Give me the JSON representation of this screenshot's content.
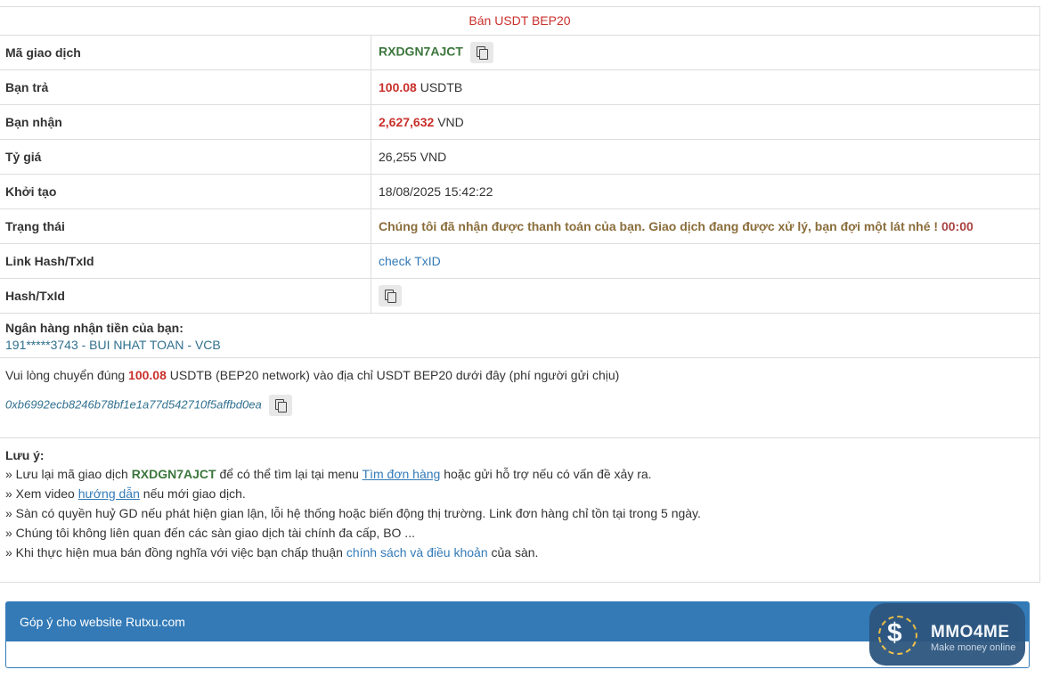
{
  "header": {
    "title": "Bán USDT BEP20"
  },
  "rows": {
    "code": {
      "label": "Mã giao dịch",
      "value": "RXDGN7AJCT"
    },
    "pay": {
      "label": "Bạn trả",
      "amount": "100.08",
      "unit": "USDTB"
    },
    "receive": {
      "label": "Bạn nhận",
      "amount": "2,627,632",
      "unit": "VND"
    },
    "rate": {
      "label": "Tỷ giá",
      "value": "26,255 VND"
    },
    "created": {
      "label": "Khởi tạo",
      "value": "18/08/2025 15:42:22"
    },
    "status": {
      "label": "Trạng thái",
      "value": "Chúng tôi đã nhận được thanh toán của bạn. Giao dịch đang được xử lý, bạn đợi một lát nhé !",
      "timer": "00:00"
    },
    "linkhash": {
      "label": "Link Hash/TxId",
      "value": "check TxID"
    },
    "hash": {
      "label": "Hash/TxId"
    }
  },
  "bank": {
    "title": "Ngân hàng nhận tiền của bạn:",
    "account": "191*****3743 - BUI NHAT TOAN - VCB"
  },
  "transfer": {
    "prefix": "Vui lòng chuyển đúng",
    "amount": "100.08",
    "suffix": "USDTB (BEP20 network) vào địa chỉ USDT BEP20 dưới đây (phí người gửi chịu)",
    "address": "0xb6992ecb8246b78bf1e1a77d542710f5affbd0ea"
  },
  "notes": {
    "title": "Lưu ý:",
    "n1_a": "» Lưu lại mã giao dịch",
    "n1_code": "RXDGN7AJCT",
    "n1_b": "để có thể tìm lại tại menu",
    "n1_link": "Tìm đơn hàng",
    "n1_c": "hoặc gửi hỗ trợ nếu có vấn đề xảy ra.",
    "n2_a": "» Xem video",
    "n2_link": "hướng dẫn",
    "n2_b": "nếu mới giao dịch.",
    "n3": "» Sàn có quyền huỷ GD nếu phát hiện gian lận, lỗi hệ thống hoặc biến động thị trường. Link đơn hàng chỉ tồn tại trong 5 ngày.",
    "n4": "» Chúng tôi không liên quan đến các sàn giao dịch tài chính đa cấp, BO ...",
    "n5_a": "» Khi thực hiện mua bán đồng nghĩa với việc bạn chấp thuận",
    "n5_link": "chính sách và điều khoản",
    "n5_b": "của sàn."
  },
  "feedback": {
    "title": "Góp ý cho website Rutxu.com"
  },
  "watermark": {
    "name": "MMO4ME",
    "tagline": "Make money online",
    "symbol": "$"
  },
  "colors": {
    "accent": "#337ab7",
    "code_green": "#3c763d",
    "amount_red": "#c9302c",
    "status_brown": "#8a6d3b",
    "header_red": "#c9302c"
  }
}
